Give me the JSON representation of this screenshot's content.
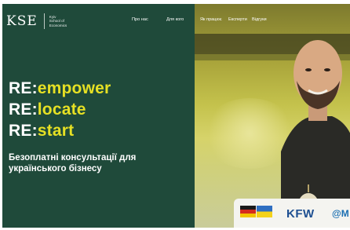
{
  "header": {
    "logo_mark": "KSE",
    "logo_lines": [
      "Kyiv",
      "School of",
      "Economics"
    ],
    "nav": [
      "Про нас",
      "Для кого",
      "Як працює",
      "Експерти",
      "Відгуки"
    ]
  },
  "hero": {
    "lines": [
      {
        "prefix": "RE:",
        "word": "empower"
      },
      {
        "prefix": "RE:",
        "word": "locate"
      },
      {
        "prefix": "RE:",
        "word": "start"
      }
    ],
    "subtitle": "Безоплатні консультації для українського бізнесу"
  },
  "partners": {
    "kfw": "KFW",
    "last": "@M"
  },
  "colors": {
    "panel_green": "#1f4a3a",
    "accent_yellow": "#e6e024",
    "kfw_blue": "#1d4f91"
  }
}
